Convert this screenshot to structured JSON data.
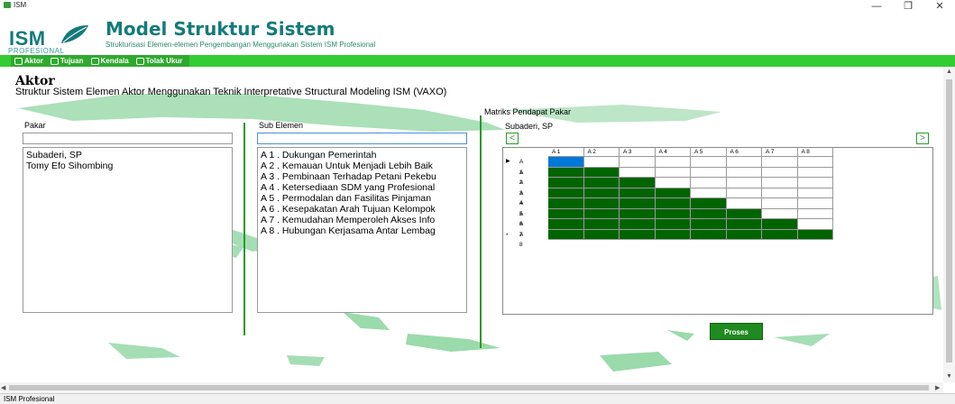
{
  "window": {
    "title": "ISM",
    "minimize": "—",
    "restore": "❐",
    "close": "✕"
  },
  "header": {
    "logo_main": "ISM",
    "logo_sub": "PROFESIONAL",
    "title": "Model Struktur Sistem",
    "subtitle": "Strukturisasi Elemen-elemen Pengembangan Menggunakan Sistem ISM Profesional"
  },
  "menu": {
    "items": [
      {
        "label": "Aktor",
        "icon": "people-icon"
      },
      {
        "label": "Tujuan",
        "icon": "target-icon"
      },
      {
        "label": "Kendala",
        "icon": "barrier-icon"
      },
      {
        "label": "Tolak Ukur",
        "icon": "measure-icon"
      }
    ]
  },
  "section": {
    "title": "Aktor",
    "description": "Struktur Sistem Elemen Aktor Menggunakan Teknik Interpretative Structural Modeling ISM (VAXO)"
  },
  "pakar": {
    "label": "Pakar",
    "search_value": "",
    "items": [
      "Subaderi, SP",
      "Tomy Efo Sihombing"
    ]
  },
  "sub_elemen": {
    "label": "Sub Elemen",
    "search_value": "",
    "items": [
      "A 1 . Dukungan Pemerintah",
      "A 2 . Kemauan Untuk Menjadi Lebih Baik",
      "A 3 . Pembinaan Terhadap Petani Pekebu",
      "A 4 . Ketersediaan SDM yang Profesional",
      "A 5 . Permodalan dan Fasilitas Pinjaman",
      "A 6 . Kesepakatan Arah Tujuan Kelompok",
      "A 7 . Kemudahan Memperoleh Akses Info",
      "A 8 . Hubungan Kerjasama Antar Lembag"
    ]
  },
  "matrix": {
    "label": "Matriks Pendapat Pakar",
    "expert": "Subaderi, SP",
    "prev": "<",
    "next": ">",
    "columns": [
      "A 1",
      "A 2",
      "A 3",
      "A 4",
      "A 5",
      "A 6",
      "A 7",
      "A 8"
    ],
    "rows": [
      "A 1",
      "A 2",
      "A 3",
      "A 4",
      "A 5",
      "A 6",
      "A 7",
      "A 8"
    ],
    "current_row_marker": "▶",
    "new_row_marker": "*",
    "selected_cell": [
      0,
      0
    ],
    "colors": {
      "filled": "#006400",
      "selected": "#0078d7",
      "empty": "#ffffff"
    }
  },
  "actions": {
    "proses": "Proses"
  },
  "status": {
    "text": "ISM Profesional"
  }
}
